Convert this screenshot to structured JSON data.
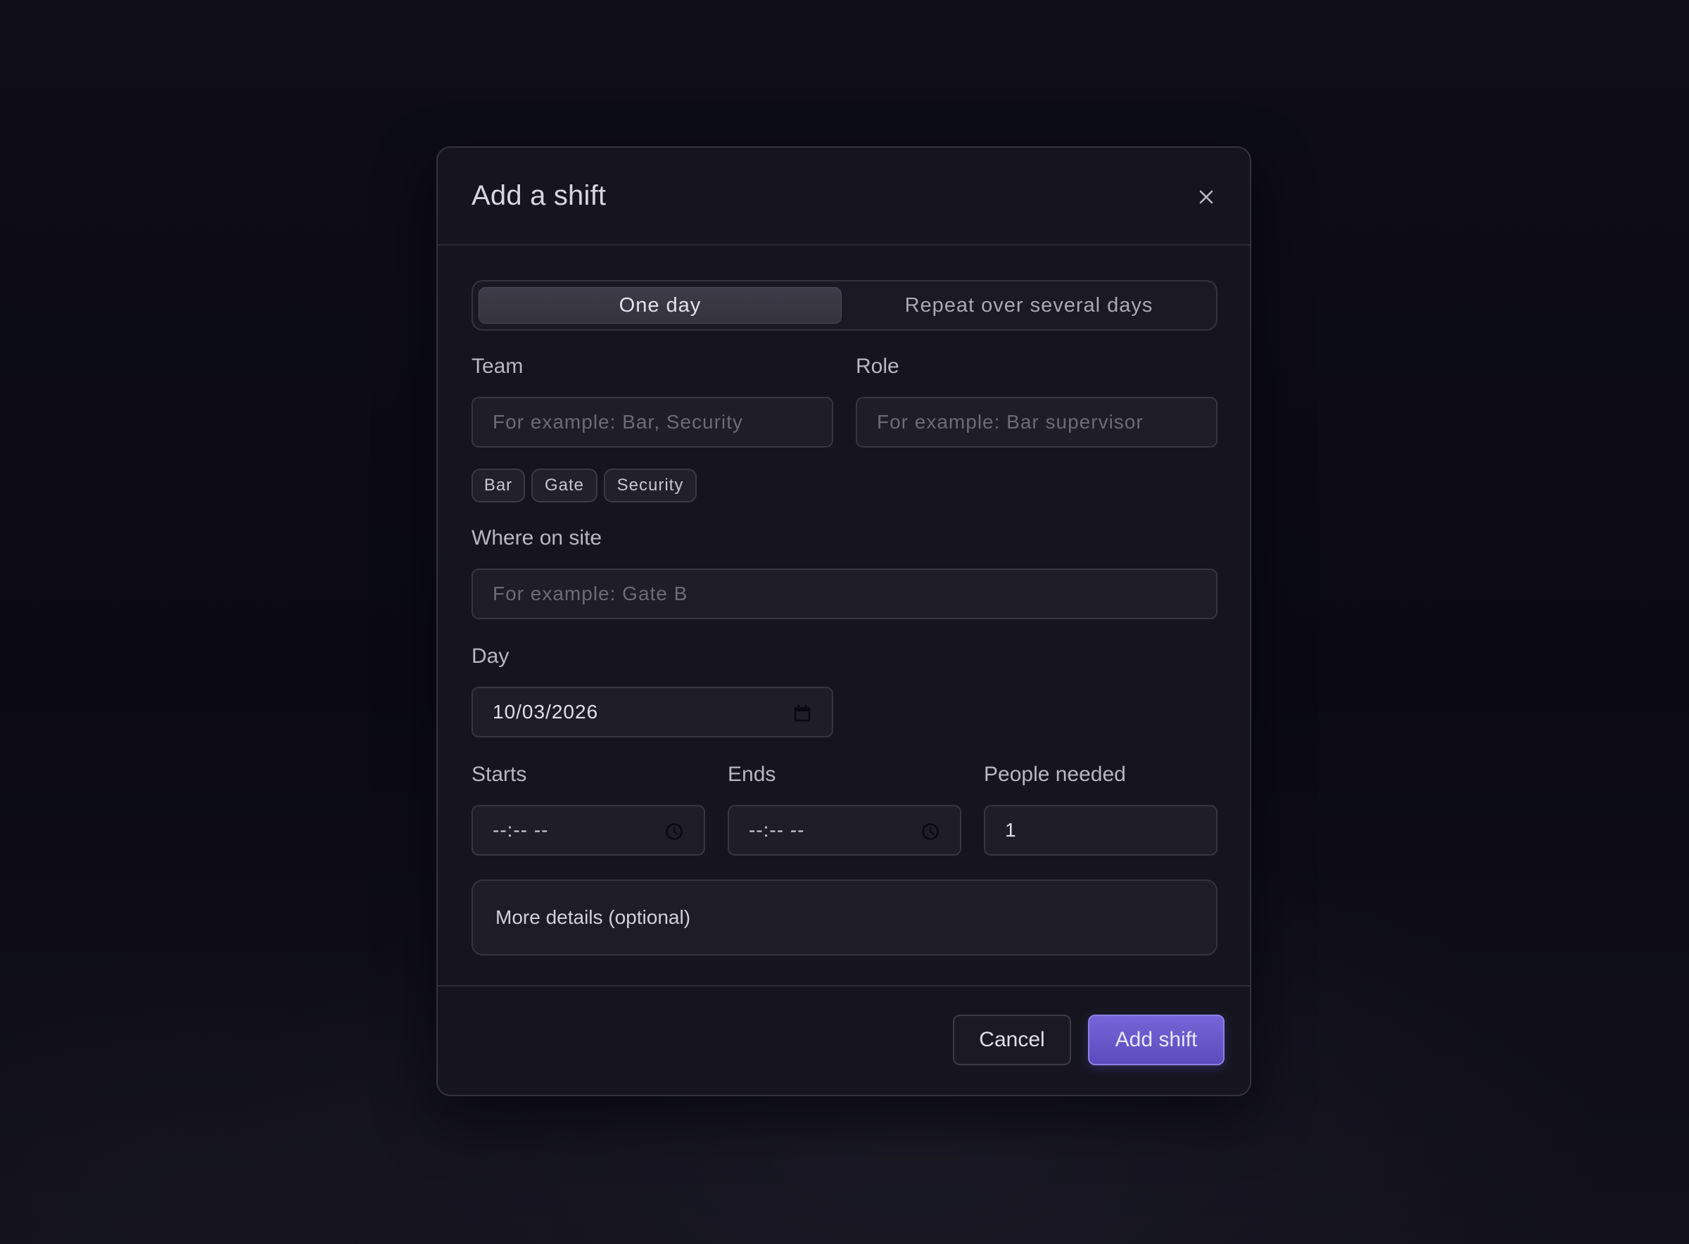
{
  "dialog": {
    "title": "Add a shift",
    "close_label": "×"
  },
  "mode": {
    "options": [
      "One day",
      "Repeat over several days"
    ],
    "selected": "One day"
  },
  "form": {
    "team": {
      "label": "Team",
      "placeholder": "For example: Bar, Security",
      "value": "",
      "suggestions": [
        "Bar",
        "Gate",
        "Security"
      ]
    },
    "role": {
      "label": "Role",
      "placeholder": "For example: Bar supervisor",
      "value": ""
    },
    "location": {
      "label": "Where on site",
      "placeholder": "For example: Gate B",
      "value": ""
    },
    "day": {
      "label": "Day",
      "value": "10/03/2026"
    },
    "starts": {
      "label": "Starts",
      "value": "--:-- --"
    },
    "ends": {
      "label": "Ends",
      "value": "--:-- --"
    },
    "people_needed": {
      "label": "People needed",
      "value": "1"
    },
    "more_details": {
      "label": "More details (optional)"
    }
  },
  "footer": {
    "cancel_label": "Cancel",
    "submit_label": "Add shift"
  },
  "colors": {
    "accent": "#6a5cd0",
    "background": "#0d0c16",
    "surface": "#16151f"
  }
}
